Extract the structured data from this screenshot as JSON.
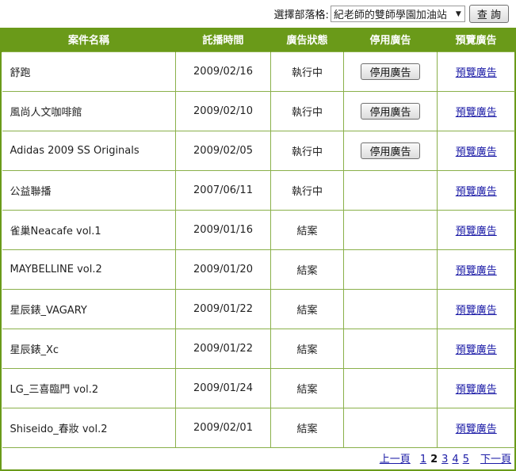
{
  "filter": {
    "label": "選擇部落格:",
    "selected": "紀老師的雙師學園加油站",
    "query_button": "查 詢"
  },
  "table": {
    "headers": [
      "案件名稱",
      "託播時間",
      "廣告狀態",
      "停用廣告",
      "預覽廣告"
    ],
    "rows": [
      {
        "name": "舒跑",
        "date": "2009/02/16",
        "status": "執行中",
        "stop": "停用廣告",
        "preview": "預覽廣告"
      },
      {
        "name": "風尚人文咖啡館",
        "date": "2009/02/10",
        "status": "執行中",
        "stop": "停用廣告",
        "preview": "預覽廣告"
      },
      {
        "name": "Adidas 2009 SS Originals",
        "date": "2009/02/05",
        "status": "執行中",
        "stop": "停用廣告",
        "preview": "預覽廣告"
      },
      {
        "name": "公益聯播",
        "date": "2007/06/11",
        "status": "執行中",
        "stop": "",
        "preview": "預覽廣告"
      },
      {
        "name": "雀巢Neacafe vol.1",
        "date": "2009/01/16",
        "status": "結案",
        "stop": "",
        "preview": "預覽廣告"
      },
      {
        "name": "MAYBELLINE vol.2",
        "date": "2009/01/20",
        "status": "結案",
        "stop": "",
        "preview": "預覽廣告"
      },
      {
        "name": "星辰錶_VAGARY",
        "date": "2009/01/22",
        "status": "結案",
        "stop": "",
        "preview": "預覽廣告"
      },
      {
        "name": "星辰錶_Xc",
        "date": "2009/01/22",
        "status": "結案",
        "stop": "",
        "preview": "預覽廣告"
      },
      {
        "name": "LG_三喜臨門 vol.2",
        "date": "2009/01/24",
        "status": "結案",
        "stop": "",
        "preview": "預覽廣告"
      },
      {
        "name": "Shiseido_春妝 vol.2",
        "date": "2009/02/01",
        "status": "結案",
        "stop": "",
        "preview": "預覽廣告"
      }
    ]
  },
  "pager": {
    "prev": "上一頁",
    "pages": [
      "1",
      "2",
      "3",
      "4",
      "5"
    ],
    "current": "2",
    "next": "下一頁"
  },
  "colors": {
    "header_bg": "#6a9a19",
    "border": "#8ab04a",
    "done_status": "#2f8a1d",
    "link": "#1a1aa6"
  }
}
